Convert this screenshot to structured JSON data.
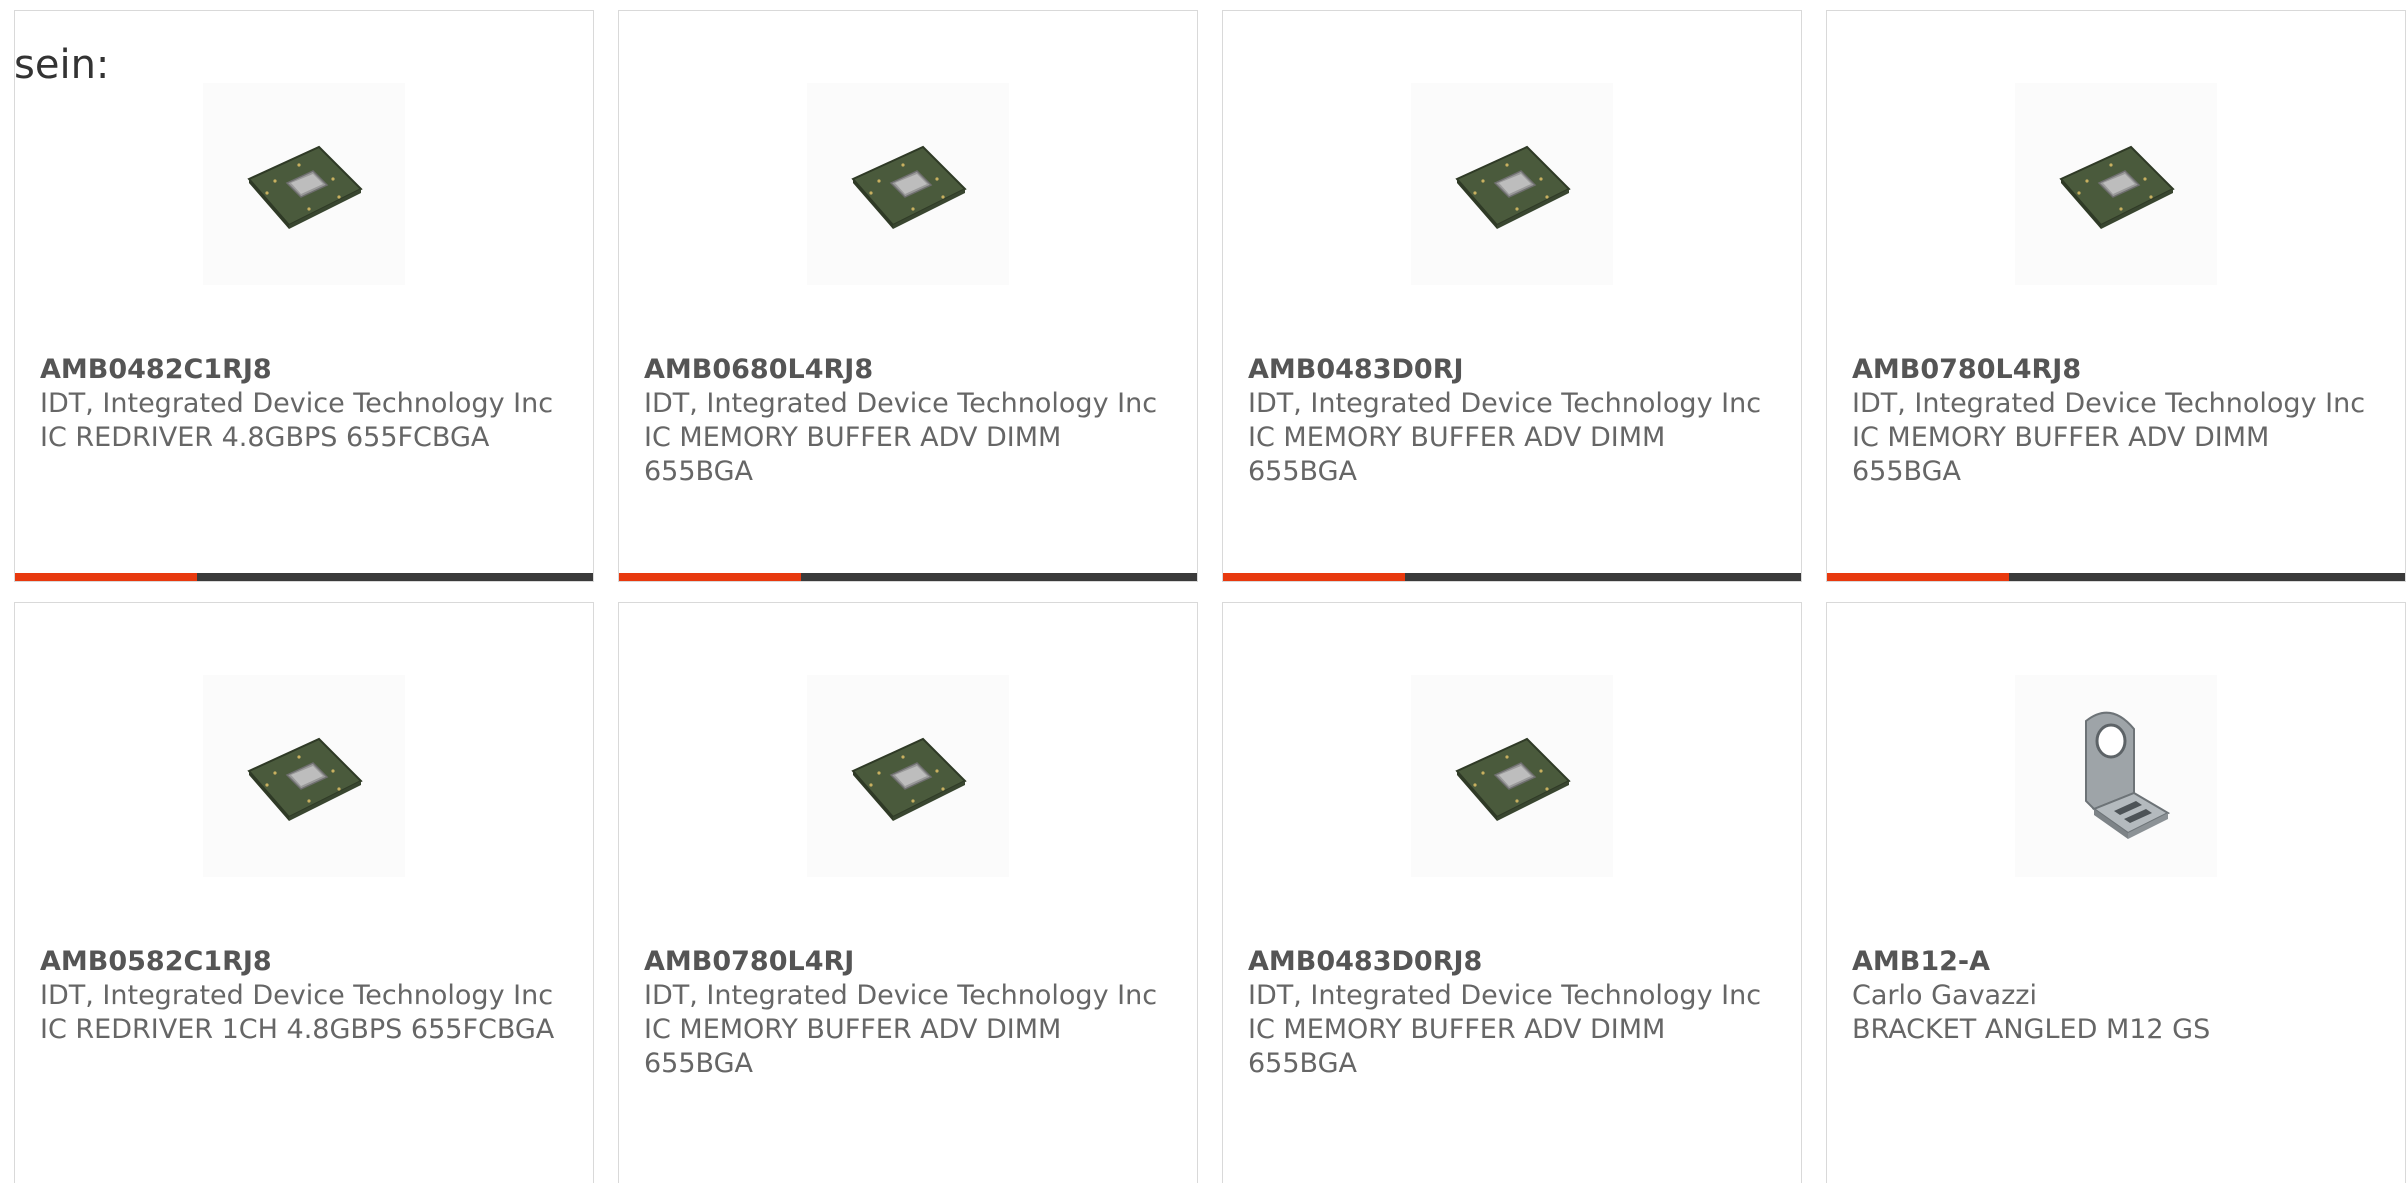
{
  "intro_text": "sein:",
  "colors": {
    "accent": "#e8390e",
    "bar": "#3a3a3a",
    "text": "#666666",
    "border": "#d9d9d9"
  },
  "products": [
    {
      "part_number": "AMB0482C1RJ8",
      "manufacturer": "IDT, Integrated Device Technology Inc",
      "description": "IC REDRIVER 4.8GBPS 655FCBGA",
      "icon": "chip-icon"
    },
    {
      "part_number": "AMB0680L4RJ8",
      "manufacturer": "IDT, Integrated Device Technology Inc",
      "description": "IC MEMORY BUFFER ADV DIMM 655BGA",
      "icon": "chip-icon"
    },
    {
      "part_number": "AMB0483D0RJ",
      "manufacturer": "IDT, Integrated Device Technology Inc",
      "description": "IC MEMORY BUFFER ADV DIMM 655BGA",
      "icon": "chip-icon"
    },
    {
      "part_number": "AMB0780L4RJ8",
      "manufacturer": "IDT, Integrated Device Technology Inc",
      "description": "IC MEMORY BUFFER ADV DIMM 655BGA",
      "icon": "chip-icon"
    },
    {
      "part_number": "AMB0582C1RJ8",
      "manufacturer": "IDT, Integrated Device Technology Inc",
      "description": "IC REDRIVER 1CH 4.8GBPS 655FCBGA",
      "icon": "chip-icon"
    },
    {
      "part_number": "AMB0780L4RJ",
      "manufacturer": "IDT, Integrated Device Technology Inc",
      "description": "IC MEMORY BUFFER ADV DIMM 655BGA",
      "icon": "chip-icon"
    },
    {
      "part_number": "AMB0483D0RJ8",
      "manufacturer": "IDT, Integrated Device Technology Inc",
      "description": "IC MEMORY BUFFER ADV DIMM 655BGA",
      "icon": "chip-icon"
    },
    {
      "part_number": "AMB12-A",
      "manufacturer": "Carlo Gavazzi",
      "description": "BRACKET ANGLED M12 GS",
      "icon": "bracket-icon"
    }
  ]
}
